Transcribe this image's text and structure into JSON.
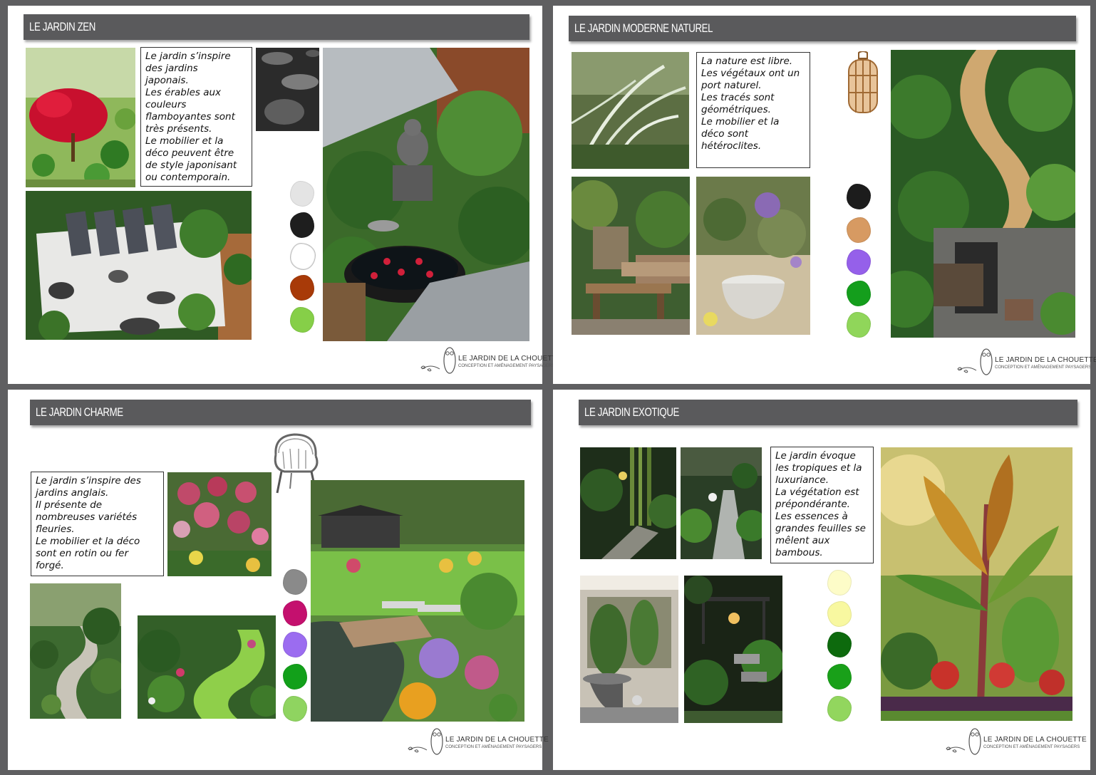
{
  "panels": {
    "zen": {
      "title": "LE JARDIN ZEN",
      "lines": [
        "Le jardin s’inspire",
        "des jardins",
        "japonais.",
        "Les érables aux",
        "couleurs",
        "flamboyantes sont",
        "très présents.",
        "Le mobilier et la",
        "déco peuvent être",
        "de style japonisant",
        "ou contemporain."
      ],
      "palette": [
        "#e4e4e4",
        "#1e1e1e",
        "#ffffff",
        "#a83a08",
        "#86cf48"
      ]
    },
    "moderne": {
      "title": "LE JARDIN MODERNE NATUREL",
      "lines": [
        "La nature est libre.",
        "Les végétaux ont un",
        "port naturel.",
        "Les tracés sont",
        "géométriques.",
        "Le mobilier et la",
        "déco sont",
        "hétéroclites."
      ],
      "palette": [
        "#1c1c1c",
        "#d79a62",
        "#9560ea",
        "#149e1c",
        "#90d65a"
      ]
    },
    "charme": {
      "title": "LE JARDIN CHARME",
      "lines": [
        "Le jardin s’inspire des",
        "jardins anglais.",
        "Il présente de",
        "nombreuses variétés",
        "fleuries.",
        "Le mobilier et la déco",
        "sont en rotin ou fer",
        "forgé."
      ],
      "palette": [
        "#8a8a8a",
        "#c4106e",
        "#9b6cf0",
        "#12a01a",
        "#8fd460"
      ]
    },
    "exotique": {
      "title": "LE JARDIN EXOTIQUE",
      "lines": [
        "Le jardin évoque",
        "les tropiques et la",
        "luxuriance.",
        "La végétation est",
        "prépondérante.",
        "Les essences à",
        "grandes feuilles se",
        "mêlent aux",
        "bambous."
      ],
      "palette": [
        "#fdfcc8",
        "#f8f8a0",
        "#0d6a0d",
        "#19a019",
        "#92d65e"
      ]
    }
  },
  "logo": {
    "brand": "LE JARDIN DE LA CHOUETTE",
    "tagline": "CONCEPTION ET AMÉNAGEMENT PAYSAGERS"
  },
  "icons": {
    "lantern": "lantern-icon",
    "chair": "rattan-chair-icon",
    "owl": "owl-logo-icon"
  },
  "colors": {
    "background": "#5f5f61",
    "title_bar": "#5a5a5c",
    "panel": "#ffffff"
  }
}
